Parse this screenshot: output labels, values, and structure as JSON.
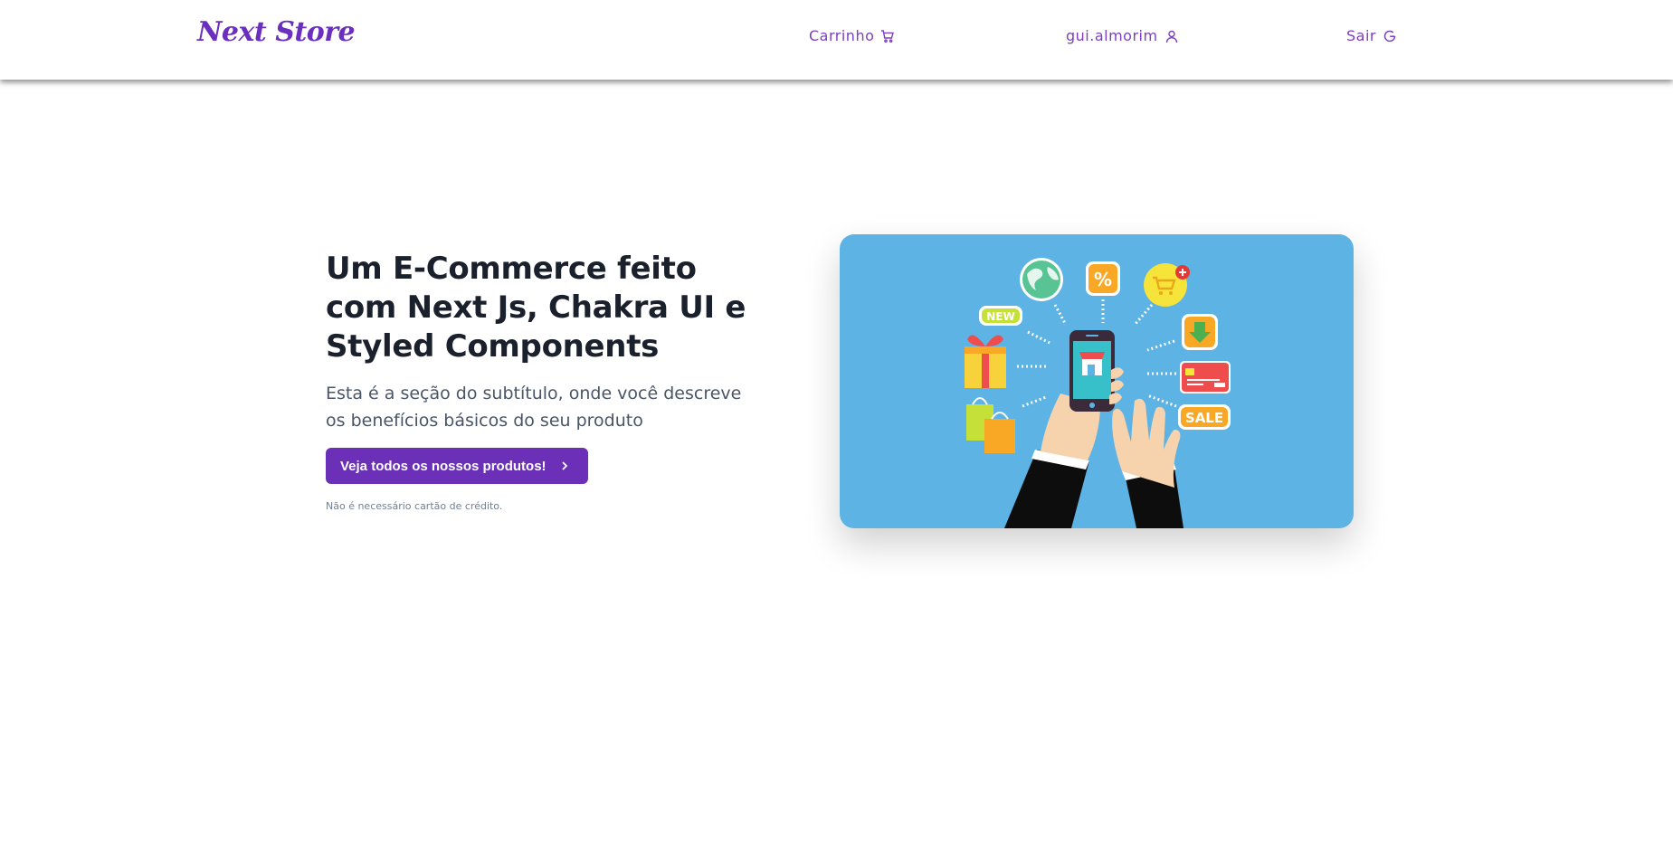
{
  "header": {
    "logo": "Next Store",
    "nav": {
      "cart_label": "Carrinho",
      "user_label": "gui.almorim",
      "logout_label": "Sair"
    }
  },
  "hero": {
    "title_line1": "Um E-Commerce feito",
    "title_line2": "com Next Js, Chakra UI e",
    "title_line3": "Styled Components",
    "subtitle": "Esta é a seção do subtítulo, onde você descreve os benefícios básicos do seu produto",
    "cta_label": "Veja todos os nossos produtos!",
    "fine_print": "Não é necessário cartão de crédito."
  },
  "illustration": {
    "badge_new": "NEW",
    "badge_sale": "SALE",
    "badge_percent": "%"
  },
  "colors": {
    "brand": "#6b2fb8",
    "card_bg": "#5db3e4"
  }
}
